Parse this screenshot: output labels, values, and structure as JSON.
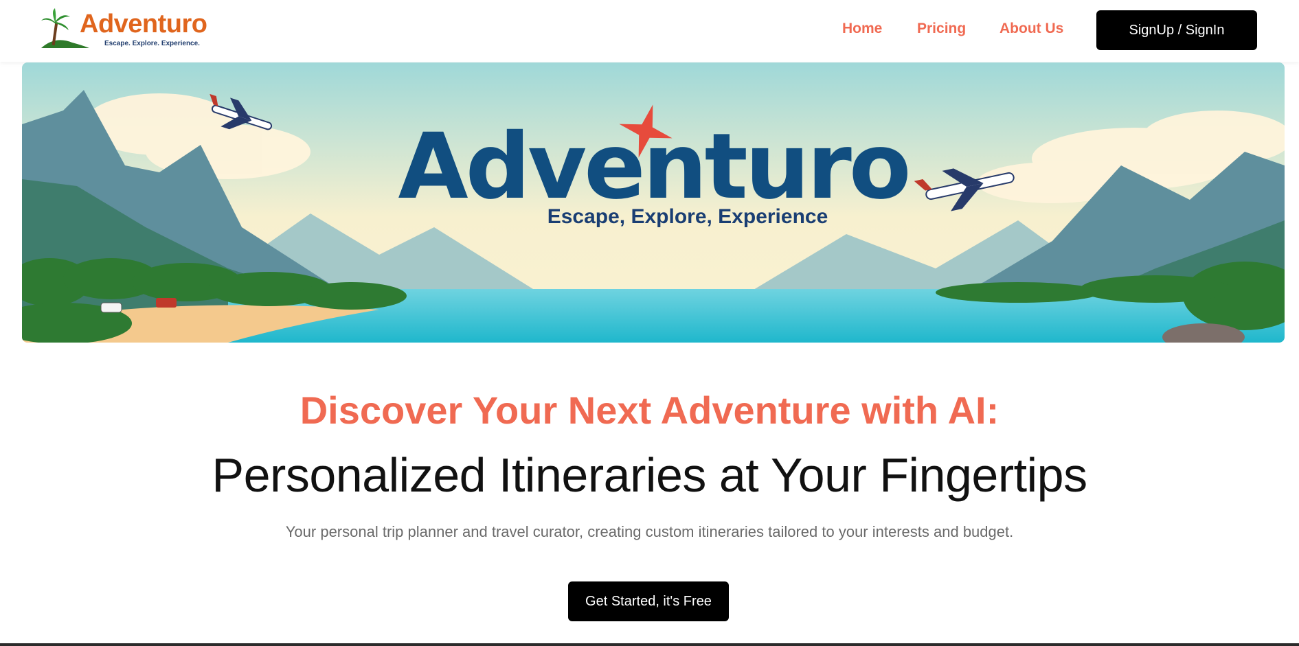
{
  "logo": {
    "name": "Adventuro",
    "tagline": "Escape. Explore. Experience.",
    "icon": "palm-tree-icon"
  },
  "nav": {
    "home": "Home",
    "pricing": "Pricing",
    "about": "About Us",
    "signup": "SignUp / SignIn"
  },
  "banner": {
    "title": "Adventuro",
    "tagline": "Escape, Explore, Experience"
  },
  "hero": {
    "heading": "Discover Your Next Adventure with AI:",
    "subheading": "Personalized Itineraries at Your Fingertips",
    "description": "Your personal trip planner and travel curator, creating custom itineraries tailored to your interests and budget.",
    "cta": "Get Started, it's Free"
  },
  "colors": {
    "accent": "#f06a52",
    "logo_orange": "#e0651d",
    "banner_title": "#114e80",
    "button_bg": "#000000"
  }
}
